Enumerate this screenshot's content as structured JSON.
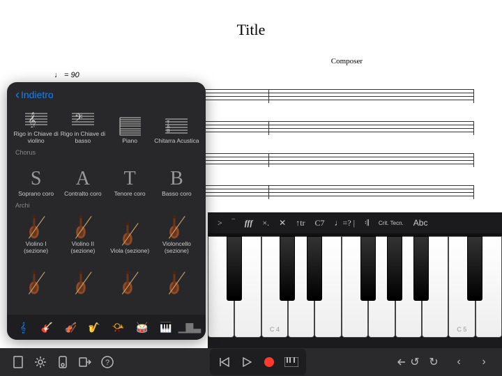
{
  "score": {
    "title": "Title",
    "composer": "Composer",
    "tempo": "♩ = 90"
  },
  "popover": {
    "back_label": "Indietro",
    "sections": {
      "basic": [
        {
          "label": "Rigo in Chiave di violino"
        },
        {
          "label": "Rigo in Chiave di basso"
        },
        {
          "label": "Piano"
        },
        {
          "label": "Chitarra Acustica"
        }
      ],
      "chorus_label": "Chorus",
      "chorus": [
        {
          "glyph": "S",
          "label": "Soprano coro"
        },
        {
          "glyph": "A",
          "label": "Contralto coro"
        },
        {
          "glyph": "T",
          "label": "Tenore coro"
        },
        {
          "glyph": "B",
          "label": "Basso coro"
        }
      ],
      "strings_label": "Archi",
      "strings": [
        {
          "label": "Violino I (sezione)"
        },
        {
          "label": "Violino II (sezione)"
        },
        {
          "label": "Viola (sezione)"
        },
        {
          "label": "Violoncello (sezione)"
        }
      ]
    }
  },
  "symbols": {
    "accent": ">",
    "marcato": "‾",
    "fff": "fff",
    "articulation": "×.",
    "cross": "✕",
    "arrow_tr": "↑tr",
    "chord": "C7",
    "note_q": "♩=? |",
    "barline": "𝄇",
    "crit": "Crit. Tecn.",
    "abc": "Abc"
  },
  "keyboard": {
    "c4": "C 4",
    "c5": "C 5"
  }
}
